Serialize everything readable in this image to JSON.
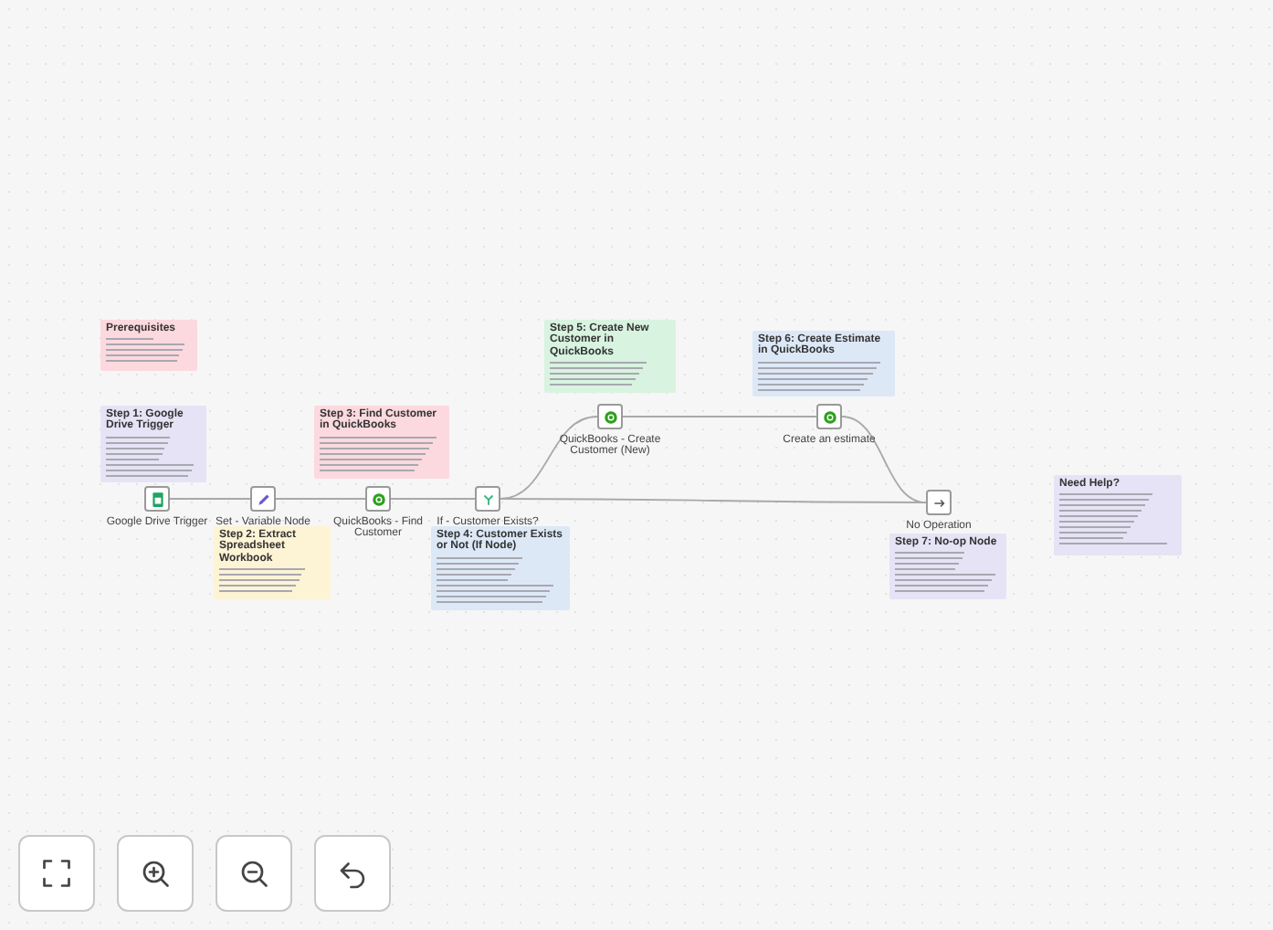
{
  "canvas": {
    "notes": [
      {
        "title": "Prerequisites",
        "color": "#fbd9df"
      },
      {
        "title": "Step 1: Google Drive Trigger",
        "color": "#e5e3f5"
      },
      {
        "title": "Step 2: Extract Spreadsheet Workbook",
        "color": "#fdf3d5"
      },
      {
        "title": "Step 3: Find Customer in QuickBooks",
        "color": "#fbd9df"
      },
      {
        "title": "Step 4: Customer Exists or Not (If Node)",
        "color": "#dde8f7"
      },
      {
        "title": "Step 5: Create New Customer in QuickBooks",
        "color": "#d8f3e0"
      },
      {
        "title": "Step 6: Create Estimate in QuickBooks",
        "color": "#dde8f7"
      },
      {
        "title": "Step 7: No-op Node",
        "color": "#e5e3f5"
      },
      {
        "title": "Need Help?",
        "color": "#e5e3f5"
      }
    ],
    "nodes": [
      {
        "kind": "drive",
        "label": "Google Drive Trigger"
      },
      {
        "kind": "edit",
        "label": "Set - Variable Node"
      },
      {
        "kind": "quickbooks",
        "label": "QuickBooks - Find Customer"
      },
      {
        "kind": "branch",
        "label": "If - Customer Exists?"
      },
      {
        "kind": "quickbooks",
        "label": "QuickBooks - Create Customer (New)"
      },
      {
        "kind": "quickbooks",
        "label": "Create an estimate"
      },
      {
        "kind": "arrow",
        "label": "No Operation"
      }
    ]
  },
  "controls": [
    {
      "kind": "fit"
    },
    {
      "kind": "zoom-in"
    },
    {
      "kind": "zoom-out"
    },
    {
      "kind": "undo"
    }
  ]
}
